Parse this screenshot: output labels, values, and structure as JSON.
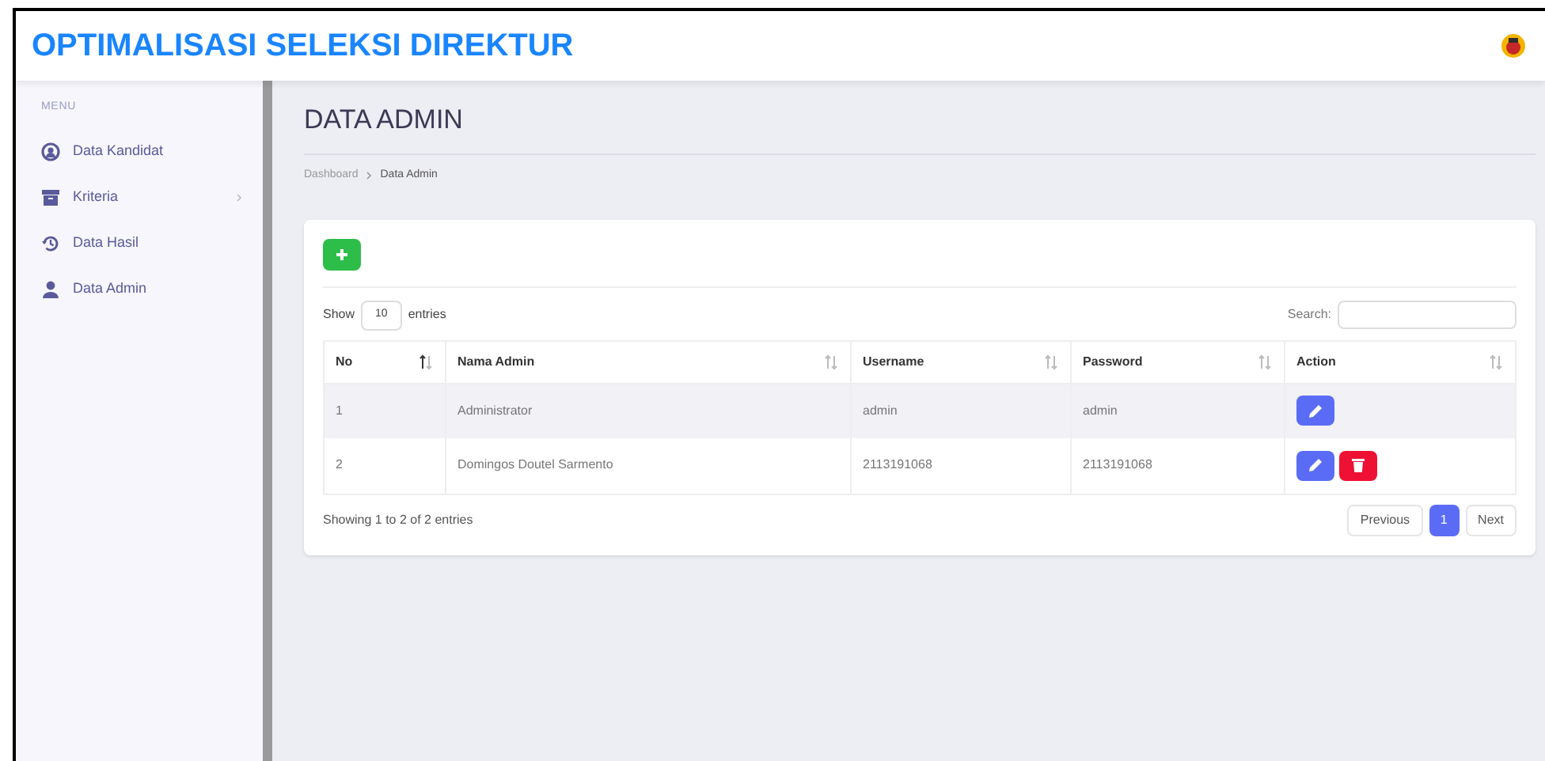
{
  "header": {
    "title": "OPTIMALISASI SELEKSI DIREKTUR"
  },
  "sidebar": {
    "heading": "MENU",
    "items": [
      {
        "label": "Data Kandidat",
        "kind": "candidates",
        "expandable": false
      },
      {
        "label": "Kriteria",
        "kind": "criteria",
        "expandable": true
      },
      {
        "label": "Data Hasil",
        "kind": "results",
        "expandable": false
      },
      {
        "label": "Data Admin",
        "kind": "admins",
        "expandable": false
      }
    ]
  },
  "page": {
    "title": "DATA ADMIN",
    "breadcrumb": [
      "Dashboard",
      "Data Admin"
    ]
  },
  "table_controls": {
    "show_label": "Show",
    "page_size": "10",
    "entries_label": "entries",
    "search_label": "Search:"
  },
  "table": {
    "columns": [
      {
        "label": "No",
        "sorted": true
      },
      {
        "label": "Nama Admin",
        "sorted": false
      },
      {
        "label": "Username",
        "sorted": false
      },
      {
        "label": "Password",
        "sorted": false
      },
      {
        "label": "Action",
        "sorted": false
      }
    ],
    "rows": [
      {
        "cells": [
          "1",
          "Administrator",
          "admin",
          "admin"
        ],
        "actions": [
          {
            "kind": "edit"
          }
        ]
      },
      {
        "cells": [
          "2",
          "Domingos Doutel Sarmento",
          "2113191068",
          "2113191068"
        ],
        "actions": [
          {
            "kind": "edit"
          },
          {
            "kind": "delete"
          }
        ]
      }
    ]
  },
  "footer": {
    "info": "Showing 1 to 2 of 2 entries",
    "previous": "Previous",
    "pages": [
      {
        "label": "1",
        "selected": true
      }
    ],
    "next": "Next"
  }
}
